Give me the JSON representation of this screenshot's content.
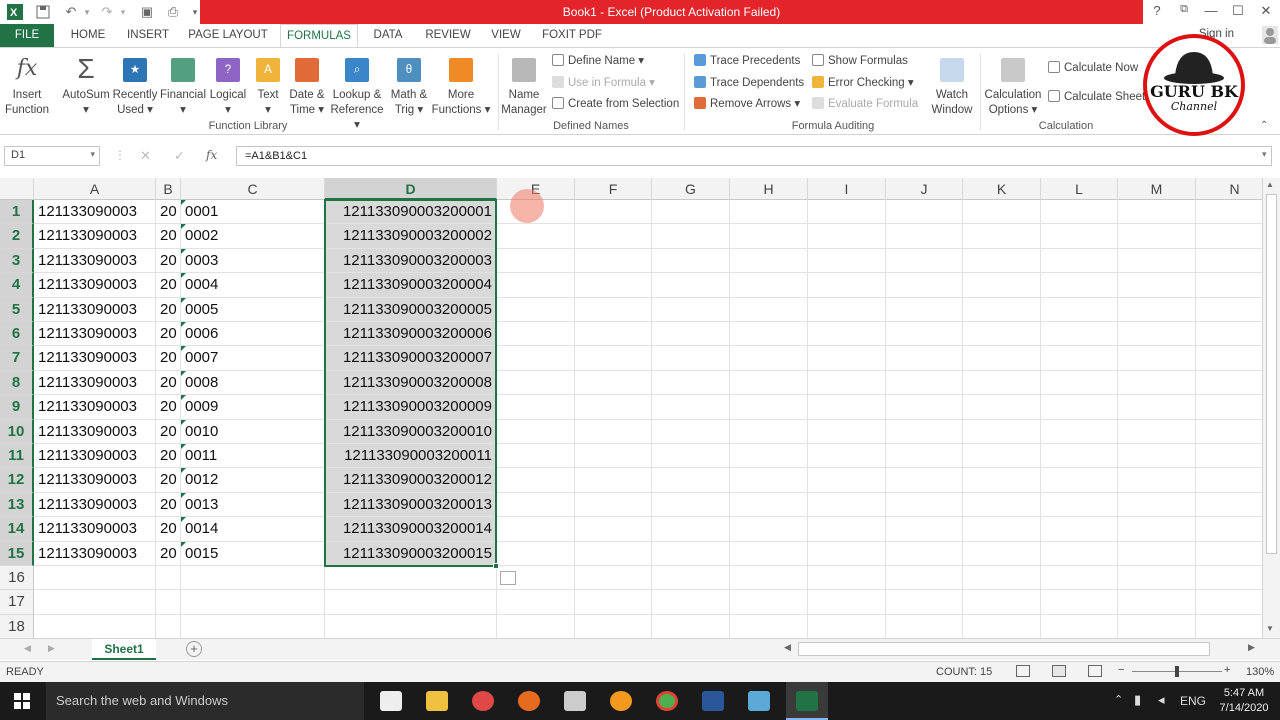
{
  "window": {
    "title": "Book1 -  Excel (Product Activation Failed)"
  },
  "titlebar": {
    "help": "?",
    "restore": "⧉",
    "minimize": "—",
    "maximize": "☐",
    "close": "✕"
  },
  "tabs": [
    "FILE",
    "HOME",
    "INSERT",
    "PAGE LAYOUT",
    "FORMULAS",
    "DATA",
    "REVIEW",
    "VIEW",
    "FOXIT PDF"
  ],
  "active_tab": "FORMULAS",
  "signin": "Sign in",
  "ribbon": {
    "insert_function": [
      "Insert",
      "Function"
    ],
    "library_buttons": [
      {
        "l1": "AutoSum",
        "l2": "▾",
        "color": "#5a5a5a"
      },
      {
        "l1": "Recently",
        "l2": "Used ▾",
        "color": "#2e75b6"
      },
      {
        "l1": "Financial",
        "l2": "▾",
        "color": "#52a080"
      },
      {
        "l1": "Logical",
        "l2": "▾",
        "color": "#8e65c4"
      },
      {
        "l1": "Text",
        "l2": "▾",
        "color": "#f0b33c"
      },
      {
        "l1": "Date &",
        "l2": "Time ▾",
        "color": "#e06b38"
      },
      {
        "l1": "Lookup &",
        "l2": "Reference ▾",
        "color": "#3a86c8"
      },
      {
        "l1": "Math &",
        "l2": "Trig ▾",
        "color": "#4f8fc0"
      },
      {
        "l1": "More",
        "l2": "Functions ▾",
        "color": "#f08a24"
      }
    ],
    "function_library_label": "Function Library",
    "name_manager": [
      "Name",
      "Manager"
    ],
    "define_name": "Define Name ▾",
    "use_in_formula": "Use in Formula ▾",
    "create_from_selection": "Create from Selection",
    "defined_names_label": "Defined Names",
    "trace_precedents": "Trace Precedents",
    "trace_dependents": "Trace Dependents",
    "remove_arrows": "Remove Arrows ▾",
    "show_formulas": "Show Formulas",
    "error_checking": "Error Checking ▾",
    "evaluate_formula": "Evaluate Formula",
    "formula_auditing_label": "Formula Auditing",
    "watch_window": [
      "Watch",
      "Window"
    ],
    "calc_options": [
      "Calculation",
      "Options ▾"
    ],
    "calculate_now": "Calculate Now",
    "calculate_sheet": "Calculate Sheet",
    "calculation_label": "Calculation"
  },
  "logo": {
    "line1": "GURU BK",
    "line2": "Channel"
  },
  "formula_bar": {
    "name_box": "D1",
    "formula": "=A1&B1&C1",
    "fx": "fx"
  },
  "columns": [
    "A",
    "B",
    "C",
    "D",
    "E",
    "F",
    "G",
    "H",
    "I",
    "J",
    "K",
    "L",
    "M",
    "N"
  ],
  "rows": [
    {
      "n": "1",
      "a": "121133090003",
      "b": "20",
      "c": "0001",
      "d": "121133090003200001"
    },
    {
      "n": "2",
      "a": "121133090003",
      "b": "20",
      "c": "0002",
      "d": "121133090003200002"
    },
    {
      "n": "3",
      "a": "121133090003",
      "b": "20",
      "c": "0003",
      "d": "121133090003200003"
    },
    {
      "n": "4",
      "a": "121133090003",
      "b": "20",
      "c": "0004",
      "d": "121133090003200004"
    },
    {
      "n": "5",
      "a": "121133090003",
      "b": "20",
      "c": "0005",
      "d": "121133090003200005"
    },
    {
      "n": "6",
      "a": "121133090003",
      "b": "20",
      "c": "0006",
      "d": "121133090003200006"
    },
    {
      "n": "7",
      "a": "121133090003",
      "b": "20",
      "c": "0007",
      "d": "121133090003200007"
    },
    {
      "n": "8",
      "a": "121133090003",
      "b": "20",
      "c": "0008",
      "d": "121133090003200008"
    },
    {
      "n": "9",
      "a": "121133090003",
      "b": "20",
      "c": "0009",
      "d": "121133090003200009"
    },
    {
      "n": "10",
      "a": "121133090003",
      "b": "20",
      "c": "0010",
      "d": "121133090003200010"
    },
    {
      "n": "11",
      "a": "121133090003",
      "b": "20",
      "c": "0011",
      "d": "121133090003200011"
    },
    {
      "n": "12",
      "a": "121133090003",
      "b": "20",
      "c": "0012",
      "d": "121133090003200012"
    },
    {
      "n": "13",
      "a": "121133090003",
      "b": "20",
      "c": "0013",
      "d": "121133090003200013"
    },
    {
      "n": "14",
      "a": "121133090003",
      "b": "20",
      "c": "0014",
      "d": "121133090003200014"
    },
    {
      "n": "15",
      "a": "121133090003",
      "b": "20",
      "c": "0015",
      "d": "121133090003200015"
    },
    {
      "n": "16",
      "a": "",
      "b": "",
      "c": "",
      "d": ""
    },
    {
      "n": "17",
      "a": "",
      "b": "",
      "c": "",
      "d": ""
    },
    {
      "n": "18",
      "a": "",
      "b": "",
      "c": "",
      "d": ""
    }
  ],
  "sheet": {
    "name": "Sheet1"
  },
  "status": {
    "ready": "READY",
    "count": "COUNT: 15",
    "zoom": "130%"
  },
  "taskbar": {
    "search": "Search the web and Windows",
    "lang": "ENG",
    "time": "5:47 AM",
    "date": "7/14/2020"
  },
  "colors": {
    "excel_green": "#217346",
    "title_red": "#e3242b"
  }
}
